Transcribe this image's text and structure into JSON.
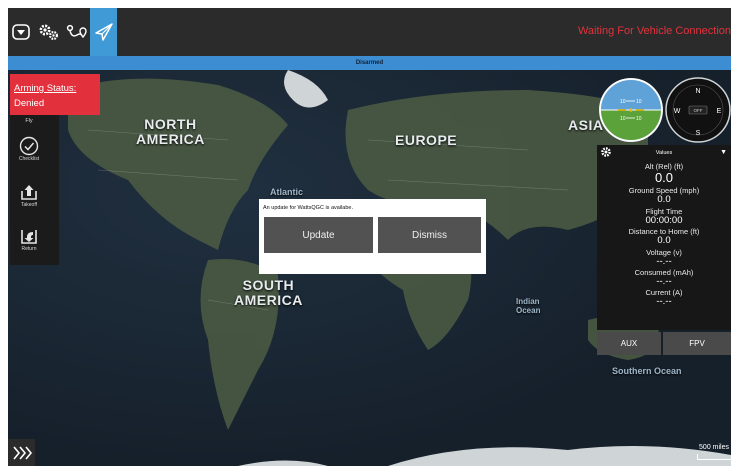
{
  "toolbar": {
    "vehicle_icon": "vehicle-logo-icon",
    "settings_icon": "gears-icon",
    "plan_icon": "route-plan-icon",
    "fly_icon": "paper-plane-icon",
    "connection_status": "Waiting For Vehicle Connection"
  },
  "status_bar": {
    "text": "Disarmed"
  },
  "arming": {
    "title": "Arming Status:",
    "value": "Denied"
  },
  "tools": {
    "fly": "Fly",
    "checklist": "Checklist",
    "takeoff": "Takeoff",
    "return": "Return"
  },
  "map": {
    "north_america": "NORTH\nAMERICA",
    "europe": "EUROPE",
    "asia": "ASIA",
    "south_america": "SOUTH\nAMERICA",
    "atlantic": "Atlantic",
    "indian_ocean": "Indian\nOcean",
    "southern_ocean": "Southern Ocean",
    "scale": "500 miles"
  },
  "instruments": {
    "attitude_ticks": [
      "10",
      "10",
      "10",
      "10"
    ],
    "compass": {
      "n": "N",
      "e": "E",
      "w": "W",
      "s": "S",
      "center": "OFF"
    }
  },
  "values_panel": {
    "title": "Values",
    "rows": [
      {
        "label": "Alt (Rel) (ft)",
        "value": "0.0"
      },
      {
        "label": "Ground Speed (mph)",
        "value": "0.0"
      },
      {
        "label": "Flight Time",
        "value": "00:00:00"
      },
      {
        "label": "Distance to Home (ft)",
        "value": "0.0"
      },
      {
        "label": "Voltage (v)",
        "value": "--.--"
      },
      {
        "label": "Consumed (mAh)",
        "value": "--.--"
      },
      {
        "label": "Current (A)",
        "value": "--.--"
      }
    ]
  },
  "buttons": {
    "aux": "AUX",
    "fpv": "FPV"
  },
  "dialog": {
    "message": "An update for WattsQGC is availabe.",
    "update": "Update",
    "dismiss": "Dismiss"
  }
}
